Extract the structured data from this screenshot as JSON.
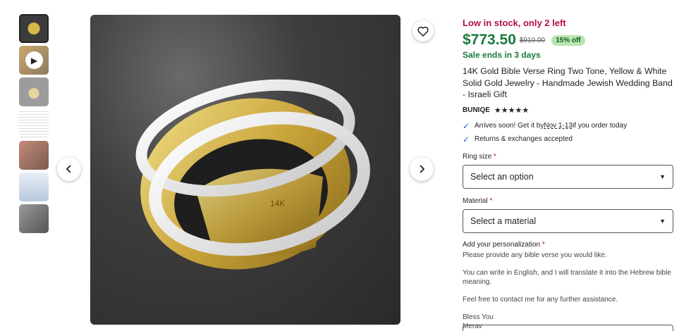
{
  "gallery": {
    "thumbnails": [
      {
        "name": "ring-thumb-1",
        "active": true
      },
      {
        "name": "video-thumb",
        "icon": "play-icon"
      },
      {
        "name": "ring-thumb-3"
      },
      {
        "name": "text-thumb"
      },
      {
        "name": "photo-thumb-5"
      },
      {
        "name": "photo-thumb-6"
      },
      {
        "name": "photo-thumb-7"
      }
    ],
    "main_image_label": "14K",
    "prev_icon": "chevron-left-icon",
    "next_icon": "chevron-right-icon",
    "favorite_icon": "heart-icon"
  },
  "product": {
    "stock": "Low in stock, only 2 left",
    "price": "$773.50",
    "original_price": "$910.00",
    "discount": "15% off",
    "sale": "Sale ends in 3 days",
    "title": "14K Gold Bible Verse Ring Two Tone, Yellow & White Solid Gold Jewelry - Handmade Jewish Wedding Band - Israeli Gift",
    "shop": "BUNIQE",
    "stars": "★★★★★",
    "delivery_prefix": "Arrives soon! Get it by ",
    "delivery_date": "Nov 1-13",
    "delivery_suffix": " if you order today",
    "returns": "Returns & exchanges accepted",
    "colors": {
      "stock": "#b3123d",
      "price": "#1a7a3c",
      "check": "#2a5dc8"
    }
  },
  "options": {
    "ring_size": {
      "label": "Ring size",
      "value": "Select an option"
    },
    "material": {
      "label": "Material",
      "value": "Select a material"
    },
    "personalization": {
      "label": "Add your personalization",
      "lines": [
        "Please provide any bible verse you would like.",
        "You can write in English, and I will translate it into the Hebrew bible meaning.",
        "Feel free to contact me for any further assistance.",
        "Bless You",
        "Merav"
      ]
    },
    "required_mark": "*"
  }
}
